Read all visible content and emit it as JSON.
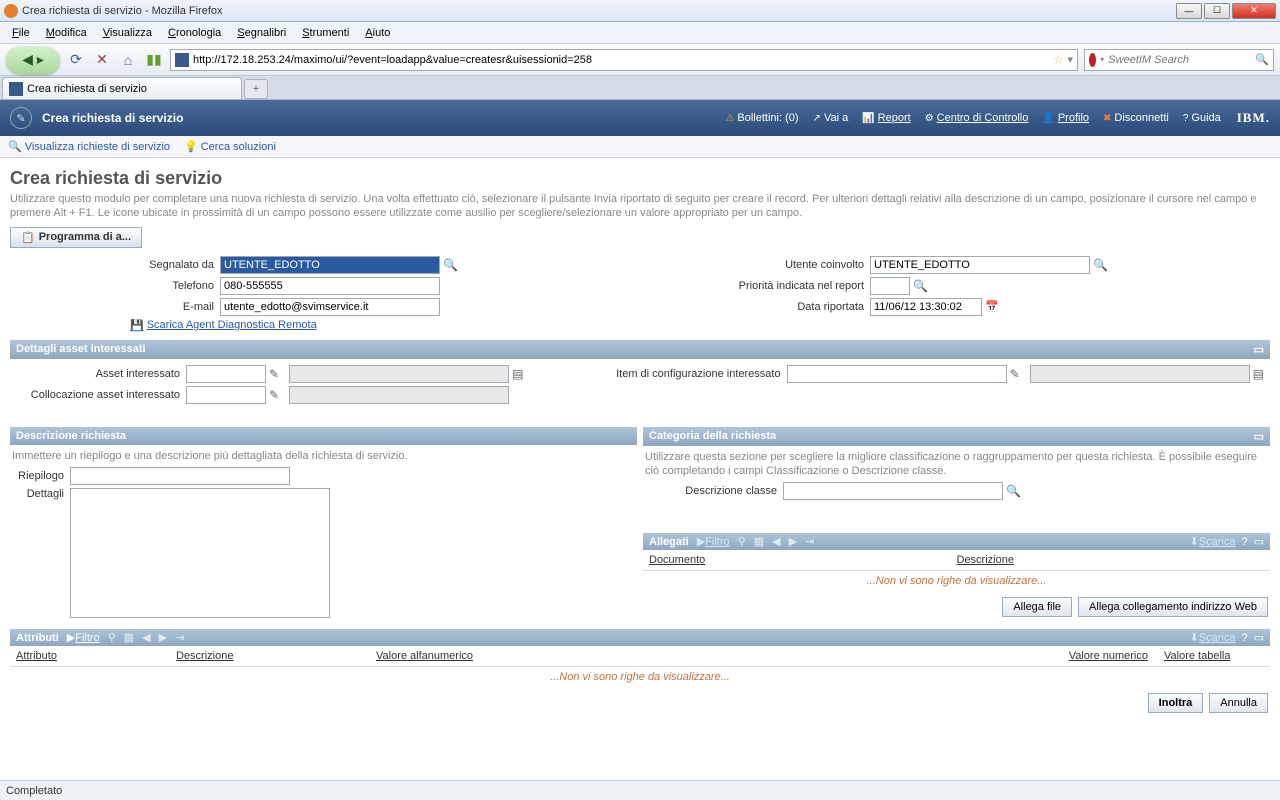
{
  "window": {
    "title": "Crea richiesta di servizio - Mozilla Firefox"
  },
  "menu": [
    "File",
    "Modifica",
    "Visualizza",
    "Cronologia",
    "Segnalibri",
    "Strumenti",
    "Aiuto"
  ],
  "url": "http://172.18.253.24/maximo/ui/?event=loadapp&value=createsr&uisessionid=258",
  "search_placeholder": "SweetIM Search",
  "tab": {
    "label": "Crea richiesta di servizio"
  },
  "app": {
    "title": "Crea richiesta di servizio",
    "links": {
      "bollettini": "Bollettini: (0)",
      "vai_a": "Vai a",
      "report": "Report",
      "centro": "Centro di Controllo",
      "profilo": "Profilo",
      "disconnetti": "Disconnetti",
      "guida": "Guida"
    },
    "logo": "IBM."
  },
  "subnav": {
    "visualizza": "Visualizza richieste di servizio",
    "cerca": "Cerca soluzioni"
  },
  "page": {
    "title": "Crea richiesta di servizio",
    "intro": "Utilizzare questo modulo per completare una nuova richiesta di servizio. Una volta effettuato ciò, selezionare il pulsante Invia riportato di seguito per creare il record. Per ulteriori dettagli relativi alla descrizione di un campo, posizionare il cursore nel campo e premere Alt + F1. Le icone ubicate in prossimità di un campo possono essere utilizzate come ausilio per scegliere/selezionare un valore appropriato per un campo.",
    "program_btn": "Programma di a..."
  },
  "labels": {
    "segnalato_da": "Segnalato da",
    "telefono": "Telefono",
    "email": "E-mail",
    "agent_link": "Scarica Agent Diagnostica Remota",
    "utente_coinvolto": "Utente coinvolto",
    "priorita": "Priorità indicata nel report",
    "data_riportata": "Data riportata",
    "asset_interessato": "Asset interessato",
    "collocazione": "Collocazione asset interessato",
    "item_config": "Item di configurazione interessato",
    "riepilogo": "Riepilogo",
    "dettagli": "Dettagli",
    "descrizione_classe": "Descrizione classe"
  },
  "values": {
    "segnalato_da": "UTENTE_EDOTTO",
    "telefono": "080-555555",
    "email": "utente_edotto@svimservice.it",
    "utente_coinvolto": "UTENTE_EDOTTO",
    "priorita": "",
    "data_riportata": "11/06/12 13:30:02",
    "riepilogo": "",
    "dettagli": "",
    "descrizione_classe": ""
  },
  "sections": {
    "dettagli_asset": "Dettagli asset interessati",
    "descrizione_richiesta": "Descrizione richiesta",
    "descrizione_richiesta_sub": "Immettere un riepilogo e una descrizione più dettagliata della richiesta di servizio.",
    "categoria_richiesta": "Categoria della richiesta",
    "categoria_richiesta_sub": "Utilizzare questa sezione per scegliere la migliore classificazione o raggruppamento per questa richiesta. È possibile eseguire ciò completando i campi Classificazione o Descrizione classe.",
    "allegati": "Allegati",
    "attributi": "Attributi",
    "filtro": "Filtro",
    "scarica": "Scarica"
  },
  "allegati_cols": {
    "documento": "Documento",
    "descrizione": "Descrizione"
  },
  "allegati_btns": {
    "file": "Allega file",
    "web": "Allega collegamento indirizzo Web"
  },
  "attributi_cols": {
    "attributo": "Attributo",
    "descrizione": "Descrizione",
    "alfa": "Valore alfanumerico",
    "num": "Valore numerico",
    "tab": "Valore tabella"
  },
  "nodata": "...Non vi sono righe da visualizzare...",
  "action_btns": {
    "inoltra": "Inoltra",
    "annulla": "Annulla"
  },
  "status": "Completato"
}
